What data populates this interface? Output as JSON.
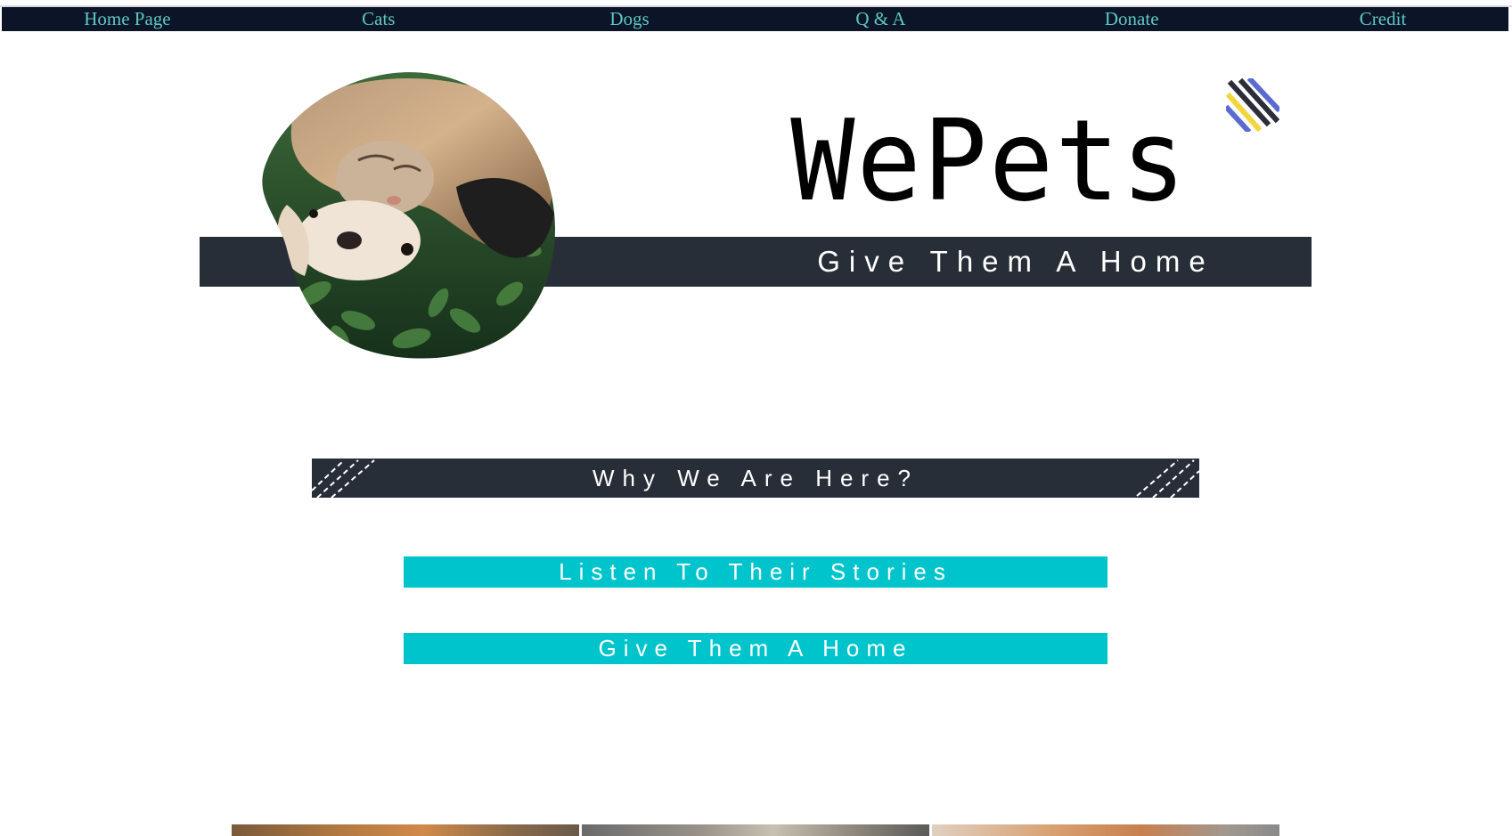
{
  "nav": {
    "items": [
      {
        "label": "Home Page"
      },
      {
        "label": "Cats"
      },
      {
        "label": "Dogs"
      },
      {
        "label": "Q & A"
      },
      {
        "label": "Donate"
      },
      {
        "label": "Credit"
      }
    ]
  },
  "hero": {
    "brand": "WePets",
    "subtitle": "Give Them A Home",
    "photo_icon": "cat-and-dog-photo"
  },
  "why": {
    "heading": "Why We Are Here?"
  },
  "actions": {
    "stories_label": "Listen To Their Stories",
    "home_label": "Give Them A Home"
  },
  "colors": {
    "nav_bg": "#0c1428",
    "nav_text": "#5ec8c0",
    "band_bg": "#282e38",
    "cta_bg": "#00c4cc"
  }
}
